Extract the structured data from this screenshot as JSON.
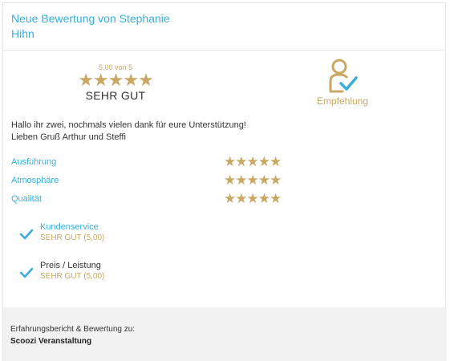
{
  "header": {
    "title": "Neue Bewertung von Stephanie Hihn"
  },
  "rating": {
    "score_label": "5,00 von 5",
    "stars": "★★★★★",
    "word": "SEHR GUT"
  },
  "recommend": {
    "label": "Empfehlung",
    "icon": "person-check-icon"
  },
  "review": {
    "text_line1": "Hallo ihr zwei, nochmals vielen dank für eure Unterstützung!",
    "text_line2": "Lieben Gruß Arthur und Steffi"
  },
  "criteria": [
    {
      "label": "Ausführung",
      "stars": "★★★★★"
    },
    {
      "label": "Atmosphäre",
      "stars": "★★★★★"
    },
    {
      "label": "Qualität",
      "stars": "★★★★★"
    }
  ],
  "checks": [
    {
      "title": "Kundenservice",
      "value": "SEHR GUT (5,00)"
    },
    {
      "title": "Preis / Leistung",
      "value": "SEHR GUT (5,00)"
    }
  ],
  "footer": {
    "label": "Erfahrungsbericht & Bewertung zu:",
    "name": "Scoozi Veranstaltung"
  },
  "colors": {
    "accent_blue": "#3aaed8",
    "gold": "#c8a864",
    "footer_bg": "#f2f2f2"
  }
}
